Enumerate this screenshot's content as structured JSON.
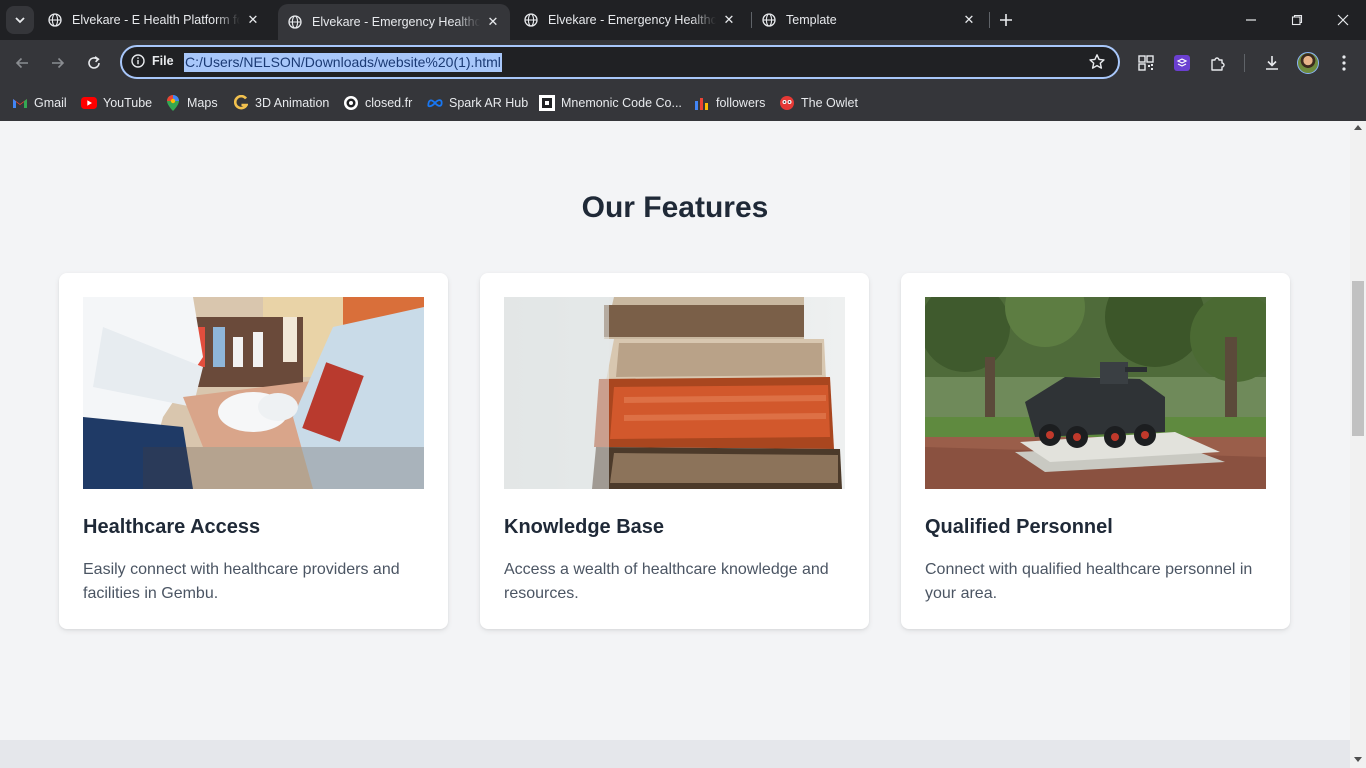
{
  "browser": {
    "tabs": [
      {
        "title": "Elvekare - E Health Platform for"
      },
      {
        "title": "Elvekare - Emergency Healthcare"
      },
      {
        "title": "Elvekare - Emergency Healthcare"
      },
      {
        "title": "Template"
      }
    ],
    "active_tab_index": 1,
    "omnibox": {
      "scheme_label": "File",
      "url": "C:/Users/NELSON/Downloads/website%20(1).html"
    },
    "bookmarks": [
      {
        "label": "Gmail",
        "icon": "gmail-icon"
      },
      {
        "label": "YouTube",
        "icon": "youtube-icon"
      },
      {
        "label": "Maps",
        "icon": "maps-icon"
      },
      {
        "label": "3D Animation",
        "icon": "g-icon"
      },
      {
        "label": "closed.fr",
        "icon": "closedfr-icon"
      },
      {
        "label": "Spark AR Hub",
        "icon": "meta-icon"
      },
      {
        "label": "Mnemonic Code Co...",
        "icon": "mnemonic-icon"
      },
      {
        "label": "followers",
        "icon": "followers-icon"
      },
      {
        "label": "The Owlet",
        "icon": "owlet-icon"
      }
    ],
    "colors": {
      "frame": "#202124",
      "toolbar": "#35363a",
      "focus_ring": "#a8c7fa"
    }
  },
  "page": {
    "section_title": "Our Features",
    "features": [
      {
        "title": "Healthcare Access",
        "description": "Easily connect with healthcare providers and facilities in Gembu.",
        "image": "blood-draw-photo"
      },
      {
        "title": "Knowledge Base",
        "description": "Access a wealth of healthcare knowledge and resources.",
        "image": "books-stack-photo"
      },
      {
        "title": "Qualified Personnel",
        "description": "Connect with qualified healthcare personnel in your area.",
        "image": "armored-vehicle-photo"
      }
    ],
    "colors": {
      "background": "#f3f4f6",
      "card": "#ffffff",
      "heading": "#1f2937",
      "text": "#4b5563"
    }
  }
}
